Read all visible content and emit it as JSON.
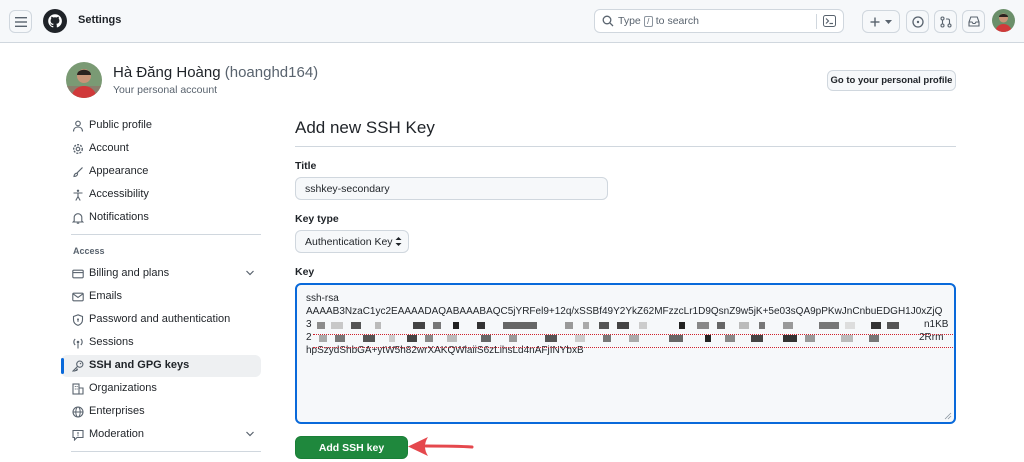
{
  "header": {
    "title": "Settings",
    "search": {
      "prefix": "Type",
      "key": "/",
      "suffix": "to search"
    }
  },
  "profile": {
    "full_name": "Hà Đăng Hoàng",
    "username": "(hoanghd164)",
    "subtitle": "Your personal account",
    "profile_button": "Go to your personal profile"
  },
  "sidebar": {
    "items_top": [
      {
        "label": "Public profile",
        "icon": "person-icon"
      },
      {
        "label": "Account",
        "icon": "gear-icon"
      },
      {
        "label": "Appearance",
        "icon": "paintbrush-icon"
      },
      {
        "label": "Accessibility",
        "icon": "accessibility-icon"
      },
      {
        "label": "Notifications",
        "icon": "bell-icon"
      }
    ],
    "access_label": "Access",
    "items_access": [
      {
        "label": "Billing and plans",
        "icon": "credit-card-icon",
        "expandable": true
      },
      {
        "label": "Emails",
        "icon": "mail-icon"
      },
      {
        "label": "Password and authentication",
        "icon": "shield-lock-icon"
      },
      {
        "label": "Sessions",
        "icon": "broadcast-icon"
      },
      {
        "label": "SSH and GPG keys",
        "icon": "key-icon",
        "active": true
      },
      {
        "label": "Organizations",
        "icon": "organization-icon"
      },
      {
        "label": "Enterprises",
        "icon": "globe-icon"
      },
      {
        "label": "Moderation",
        "icon": "report-icon",
        "expandable": true
      }
    ]
  },
  "form": {
    "heading": "Add new SSH Key",
    "title_label": "Title",
    "title_value": "sshkey-secondary",
    "key_type_label": "Key type",
    "key_type_value": "Authentication Key",
    "key_label": "Key",
    "key_lines": {
      "line1": "ssh-rsa",
      "line2": "AAAAB3NzaC1yc2EAAAADAQABAAABAQC5jYRFel9+12q/xSSBf49Y2YkZ62MFzzcLr1D9QsnZ9w5jK+5e03sQA9pPKwJnCnbuEDGH1J0xZjQ",
      "line3_start": "3",
      "line3_end": "n1KB",
      "line4_start": "2",
      "line4_end": "2Rrm",
      "line5": "hpSzydShbGA+ytW5h82wrXAKQWlaiiS6zLihsLd4nAFjINYbxB"
    },
    "submit_label": "Add SSH key"
  },
  "colors": {
    "accent": "#0969da",
    "submit_green": "#1f883d",
    "annotation_arrow": "#e5484d"
  }
}
